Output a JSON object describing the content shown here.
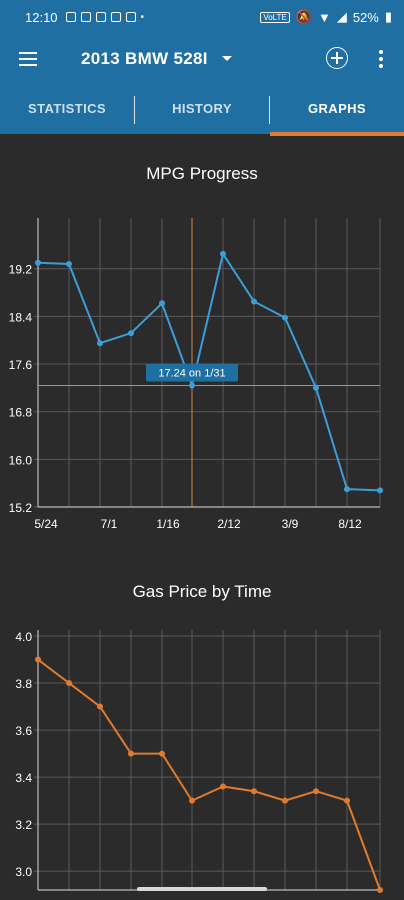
{
  "status_bar": {
    "time": "12:10",
    "volte": "VoLTE",
    "battery": "52%"
  },
  "app_bar": {
    "title": "2013 BMW 528I"
  },
  "tabs": [
    {
      "label": "STATISTICS",
      "active": false
    },
    {
      "label": "HISTORY",
      "active": false
    },
    {
      "label": "GRAPHS",
      "active": true
    }
  ],
  "colors": {
    "primary": "#1f6fa3",
    "accent": "#e07a2e",
    "mpg_line": "#3a9fd8",
    "gas_line": "#e07a2e",
    "background": "#2b2b2b"
  },
  "chart_data": [
    {
      "type": "line",
      "title": "MPG Progress",
      "x_tick_labels": [
        "5/24",
        "7/1",
        "1/16",
        "2/12",
        "3/9",
        "8/12"
      ],
      "y_tick_labels": [
        "19.2",
        "18.4",
        "17.6",
        "16.8",
        "16.0",
        "15.2"
      ],
      "ylim": [
        15.2,
        19.8
      ],
      "series": [
        {
          "values": [
            19.3,
            19.28,
            17.95,
            18.12,
            18.62,
            17.24,
            19.45,
            18.65,
            18.38,
            17.2,
            15.5,
            15.48
          ]
        }
      ],
      "tooltip": {
        "text": "17.24 on 1/31",
        "point_index": 5
      }
    },
    {
      "type": "line",
      "title": "Gas Price by Time",
      "y_tick_labels": [
        "4.0",
        "3.8",
        "3.6",
        "3.4",
        "3.2",
        "3.0"
      ],
      "ylim": [
        2.92,
        4.0
      ],
      "series": [
        {
          "values": [
            3.9,
            3.8,
            3.7,
            3.5,
            3.5,
            3.3,
            3.36,
            3.34,
            3.3,
            3.34,
            3.3,
            2.92
          ]
        }
      ]
    }
  ]
}
